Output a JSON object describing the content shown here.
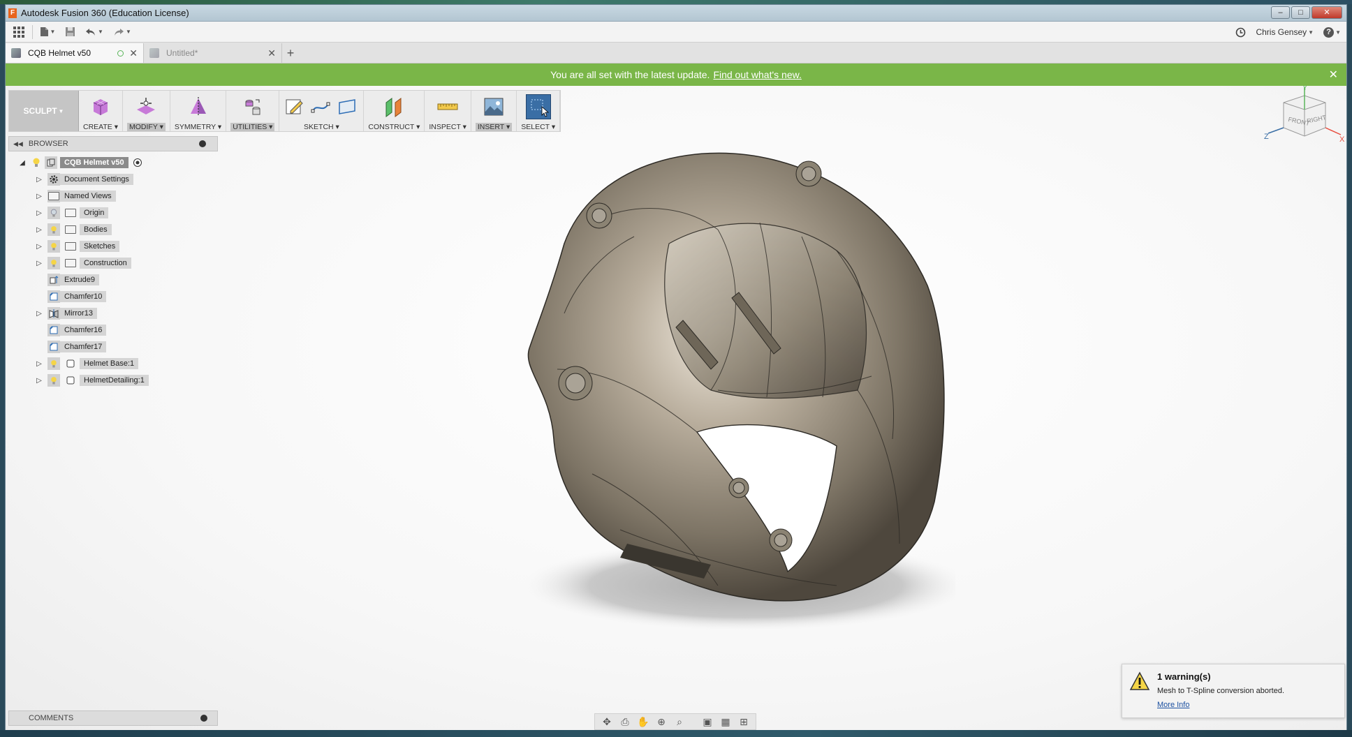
{
  "app": {
    "title": "Autodesk Fusion 360 (Education License)",
    "logo_letter": "F"
  },
  "window_controls": {
    "minimize": "–",
    "maximize": "□",
    "close": "✕"
  },
  "quick_access": {
    "user": "Chris Gensey",
    "help": "?"
  },
  "tabs": [
    {
      "label": "CQB Helmet v50",
      "close": "✕"
    },
    {
      "label": "Untitled*",
      "close": "✕"
    }
  ],
  "new_tab": "+",
  "banner": {
    "text": "You are all set with the latest update.",
    "link": "Find out what's new.",
    "close": "✕"
  },
  "ribbon": {
    "workspace": "SCULPT",
    "groups": [
      "CREATE",
      "MODIFY",
      "SYMMETRY",
      "UTILITIES",
      "SKETCH",
      "CONSTRUCT",
      "INSPECT",
      "INSERT",
      "SELECT"
    ]
  },
  "browser": {
    "title": "BROWSER",
    "root": "CQB Helmet v50",
    "items": [
      {
        "label": "Document Settings"
      },
      {
        "label": "Named Views"
      },
      {
        "label": "Origin"
      },
      {
        "label": "Bodies"
      },
      {
        "label": "Sketches"
      },
      {
        "label": "Construction"
      },
      {
        "label": "Extrude9"
      },
      {
        "label": "Chamfer10"
      },
      {
        "label": "Mirror13"
      },
      {
        "label": "Chamfer16"
      },
      {
        "label": "Chamfer17"
      },
      {
        "label": "Helmet Base:1"
      },
      {
        "label": "HelmetDetailing:1"
      }
    ]
  },
  "viewcube": {
    "front": "FRONT",
    "right": "RIGHT",
    "axis_x": "X",
    "axis_y": "Y",
    "axis_z": "Z"
  },
  "comments": {
    "title": "COMMENTS"
  },
  "warning": {
    "title": "1 warning(s)",
    "message": "Mesh to T-Spline conversion aborted.",
    "link": "More Info"
  },
  "colors": {
    "banner": "#7ab648",
    "accent": "#3a6ea5",
    "root_node": "#8b8b8b"
  }
}
